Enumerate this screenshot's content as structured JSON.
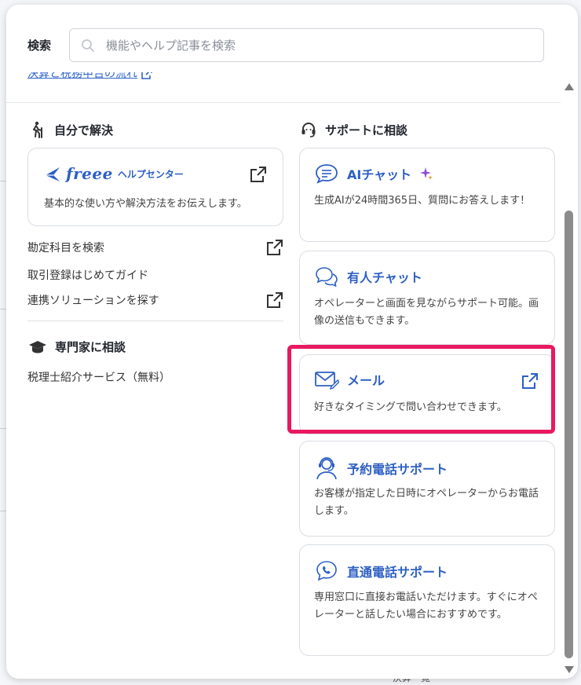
{
  "search": {
    "label": "検索",
    "placeholder": "機能やヘルプ記事を検索",
    "cut_link": "決算と税務申告の流れ"
  },
  "self_solve": {
    "title": "自分で解決",
    "help_center": {
      "brand": "freee",
      "label": "ヘルプセンター",
      "desc": "基本的な使い方や解決方法をお伝えします。"
    },
    "links": [
      {
        "label": "勘定科目を検索",
        "external": true
      },
      {
        "label": "取引登録はじめてガイド",
        "external": false
      },
      {
        "label": "連携ソリューションを探す",
        "external": true
      }
    ]
  },
  "expert": {
    "title": "専門家に相談",
    "links": [
      {
        "label": "税理士紹介サービス（無料）"
      }
    ]
  },
  "support": {
    "title": "サポートに相談",
    "cards": [
      {
        "title": "AIチャット",
        "desc": "生成AIが24時間365日、質問にお答えします！"
      },
      {
        "title": "有人チャット",
        "desc": "オペレーターと画面を見ながらサポート可能。画像の送信もできます。"
      },
      {
        "title": "メール",
        "desc": "好きなタイミングで問い合わせできます。"
      },
      {
        "title": "予約電話サポート",
        "desc": "お客様が指定した日時にオペレーターからお電話します。"
      },
      {
        "title": "直通電話サポート",
        "desc": "専用窓口に直接お電話いただけます。すぐにオペレーターと話したい場合におすすめです。"
      }
    ]
  },
  "background": {
    "footer_text": "決算一覧"
  },
  "colors": {
    "accent": "#2d5fc4",
    "highlight": "#e8195f",
    "ai_sparkle": "#8a4fd8"
  }
}
